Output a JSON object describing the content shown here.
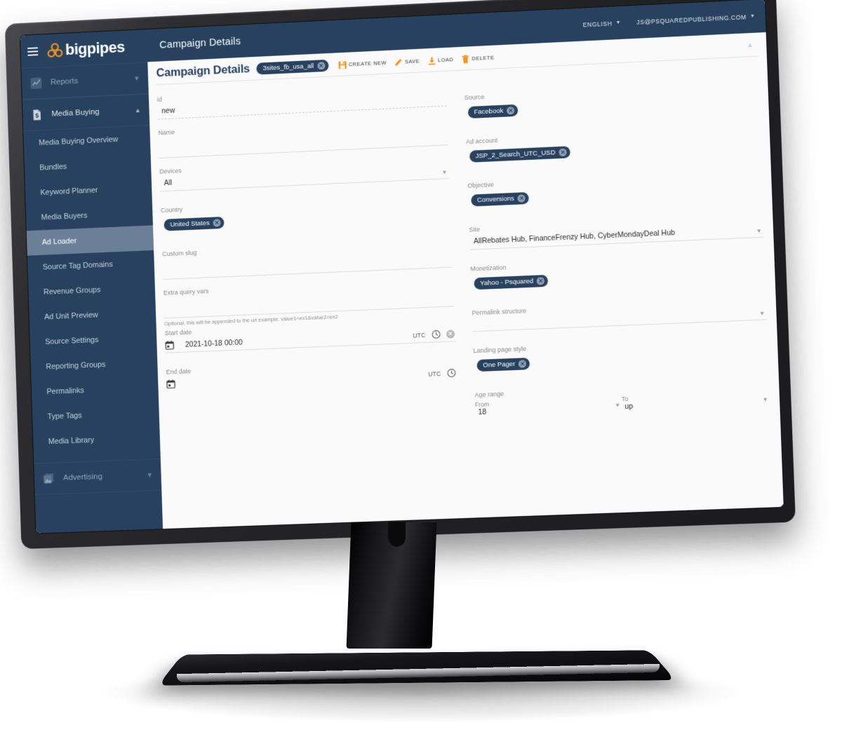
{
  "brand": {
    "name": "bigpipes",
    "logo_icon": "three-circles-icon",
    "menu_icon": "hamburger-menu-icon",
    "accent_color": "#F2921D",
    "sidebar_color": "#27415F"
  },
  "sidebar": {
    "groups": [
      {
        "label": "Reports",
        "icon": "chart-icon",
        "expanded": false,
        "chevron": "chevron-down-icon",
        "items": []
      },
      {
        "label": "Media Buying",
        "icon": "document-dollar-icon",
        "expanded": true,
        "chevron": "chevron-up-icon",
        "items": [
          {
            "label": "Media Buying Overview",
            "active": false
          },
          {
            "label": "Bundles",
            "active": false
          },
          {
            "label": "Keyword Planner",
            "active": false
          },
          {
            "label": "Media Buyers",
            "active": false
          },
          {
            "label": "Ad Loader",
            "active": true
          },
          {
            "label": "Source Tag Domains",
            "active": false
          },
          {
            "label": "Revenue Groups",
            "active": false
          },
          {
            "label": "Ad Unit Preview",
            "active": false
          },
          {
            "label": "Source Settings",
            "active": false
          },
          {
            "label": "Reporting Groups",
            "active": false
          },
          {
            "label": "Permalinks",
            "active": false
          },
          {
            "label": "Type Tags",
            "active": false
          },
          {
            "label": "Media Library",
            "active": false
          }
        ]
      },
      {
        "label": "Advertising",
        "icon": "image-icon",
        "expanded": false,
        "chevron": "chevron-down-icon",
        "items": []
      }
    ]
  },
  "topbar": {
    "title": "Campaign Details",
    "language": "ENGLISH",
    "language_caret": "chevron-down-icon",
    "account": "JS@PSQUAREDPUBLISHING.COM",
    "account_caret": "chevron-down-icon"
  },
  "card": {
    "title": "Campaign Details",
    "campaign_chip": "3sites_fb_usa_all",
    "collapse_icon": "chevron-up-icon",
    "tools": [
      {
        "label": "CREATE NEW",
        "icon": "save-disk-icon"
      },
      {
        "label": "SAVE",
        "icon": "pencil-icon"
      },
      {
        "label": "LOAD",
        "icon": "download-icon"
      },
      {
        "label": "DELETE",
        "icon": "trash-icon"
      }
    ]
  },
  "form": {
    "left": {
      "id": {
        "label": "id",
        "value": "new"
      },
      "name": {
        "label": "Name",
        "value": ""
      },
      "devices": {
        "label": "Devices",
        "value": "All",
        "caret": "chevron-down-icon"
      },
      "country": {
        "label": "Country",
        "chip": "United States"
      },
      "custom_slug": {
        "label": "Custom slug",
        "value": ""
      },
      "extra_query_vars": {
        "label": "Extra query vars",
        "value": "",
        "hint": "Optional, this will be appended to the url example: value1=ex1&value2=ex2"
      },
      "start_date": {
        "label": "Start date",
        "value": "2021-10-18 00:00",
        "tz": "UTC",
        "calendar_icon": "calendar-icon",
        "clock_icon": "clock-icon",
        "clear_icon": "clear-icon"
      },
      "end_date": {
        "label": "End date",
        "value": "",
        "tz": "UTC",
        "calendar_icon": "calendar-icon",
        "clock_icon": "clock-icon"
      }
    },
    "right": {
      "source": {
        "label": "Source",
        "chip": "Facebook"
      },
      "ad_account": {
        "label": "Ad account",
        "chip": "JSP_2_Search_UTC_USD"
      },
      "objective": {
        "label": "Objective",
        "chip": "Conversions"
      },
      "site": {
        "label": "Site",
        "value": "AllRebates Hub, FinanceFrenzy Hub, CyberMondayDeal Hub",
        "caret": "chevron-down-icon"
      },
      "monetization": {
        "label": "Monetization",
        "chip": "Yahoo - Psquared"
      },
      "permalink_structure": {
        "label": "Permalink structure",
        "value": "",
        "caret": "chevron-down-icon"
      },
      "landing_page_style": {
        "label": "Landing page style",
        "chip": "One Pager"
      },
      "age_range": {
        "label": "Age range",
        "from_label": "From",
        "from_value": "18",
        "from_caret": "chevron-down-icon",
        "to_label": "To",
        "to_value": "up",
        "to_caret": "chevron-down-icon"
      }
    }
  }
}
